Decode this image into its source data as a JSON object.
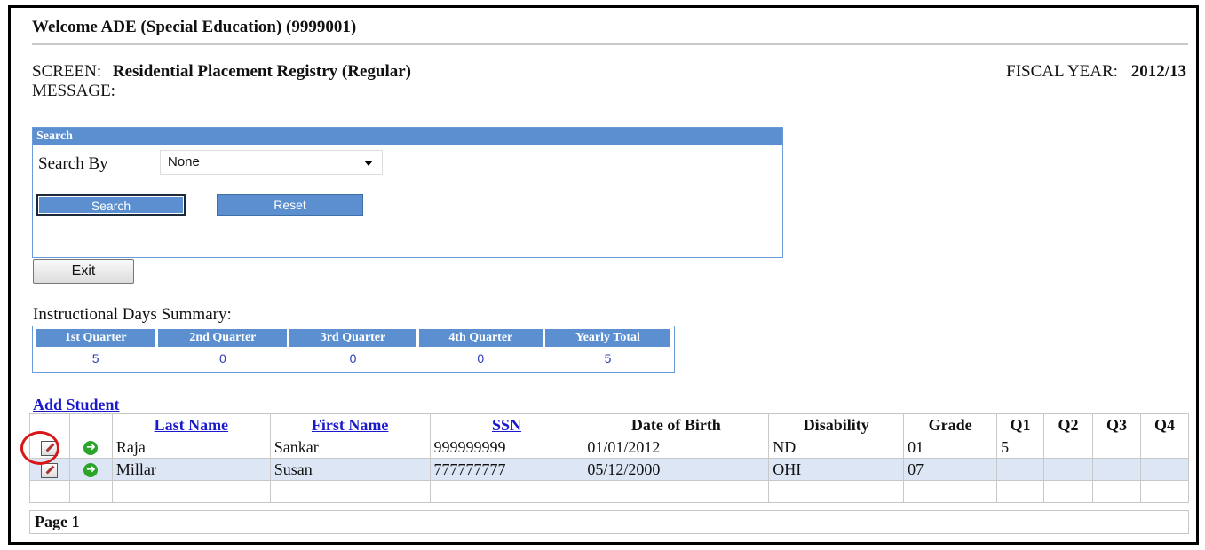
{
  "header": {
    "welcome": "Welcome ADE (Special Education) (9999001)",
    "screen_label": "SCREEN:",
    "screen_value": "Residential Placement Registry (Regular)",
    "message_label": "MESSAGE:",
    "fiscal_label": "FISCAL YEAR:",
    "fiscal_value": "2012/13"
  },
  "search": {
    "title": "Search",
    "search_by_label": "Search By",
    "search_by_value": "None",
    "search_button": "Search",
    "reset_button": "Reset"
  },
  "exit_button": "Exit",
  "instructional_days": {
    "label": "Instructional Days Summary:",
    "headers": [
      "1st Quarter",
      "2nd Quarter",
      "3rd Quarter",
      "4th Quarter",
      "Yearly Total"
    ],
    "values": [
      "5",
      "0",
      "0",
      "0",
      "5"
    ]
  },
  "add_student": "Add Student",
  "students": {
    "columns": [
      "",
      "",
      "Last Name",
      "First Name",
      "SSN",
      "Date of Birth",
      "Disability",
      "Grade",
      "Q1",
      "Q2",
      "Q3",
      "Q4"
    ],
    "rows": [
      {
        "last": "Raja",
        "first": "Sankar",
        "ssn": "999999999",
        "dob": "01/01/2012",
        "disability": "ND",
        "grade": "01",
        "q1": "5",
        "q2": "",
        "q3": "",
        "q4": ""
      },
      {
        "last": "Millar",
        "first": "Susan",
        "ssn": "777777777",
        "dob": "05/12/2000",
        "disability": "OHI",
        "grade": "07",
        "q1": "",
        "q2": "",
        "q3": "",
        "q4": ""
      }
    ]
  },
  "pager": "Page 1",
  "icons": {
    "edit": "edit-icon",
    "go": "go-arrow-icon",
    "dropdown": "chevron-down-icon"
  },
  "colors": {
    "header_blue": "#5b8fd0",
    "link_blue": "#1a1acc",
    "alt_row": "#dce6f4",
    "highlight_red": "#d81818"
  }
}
